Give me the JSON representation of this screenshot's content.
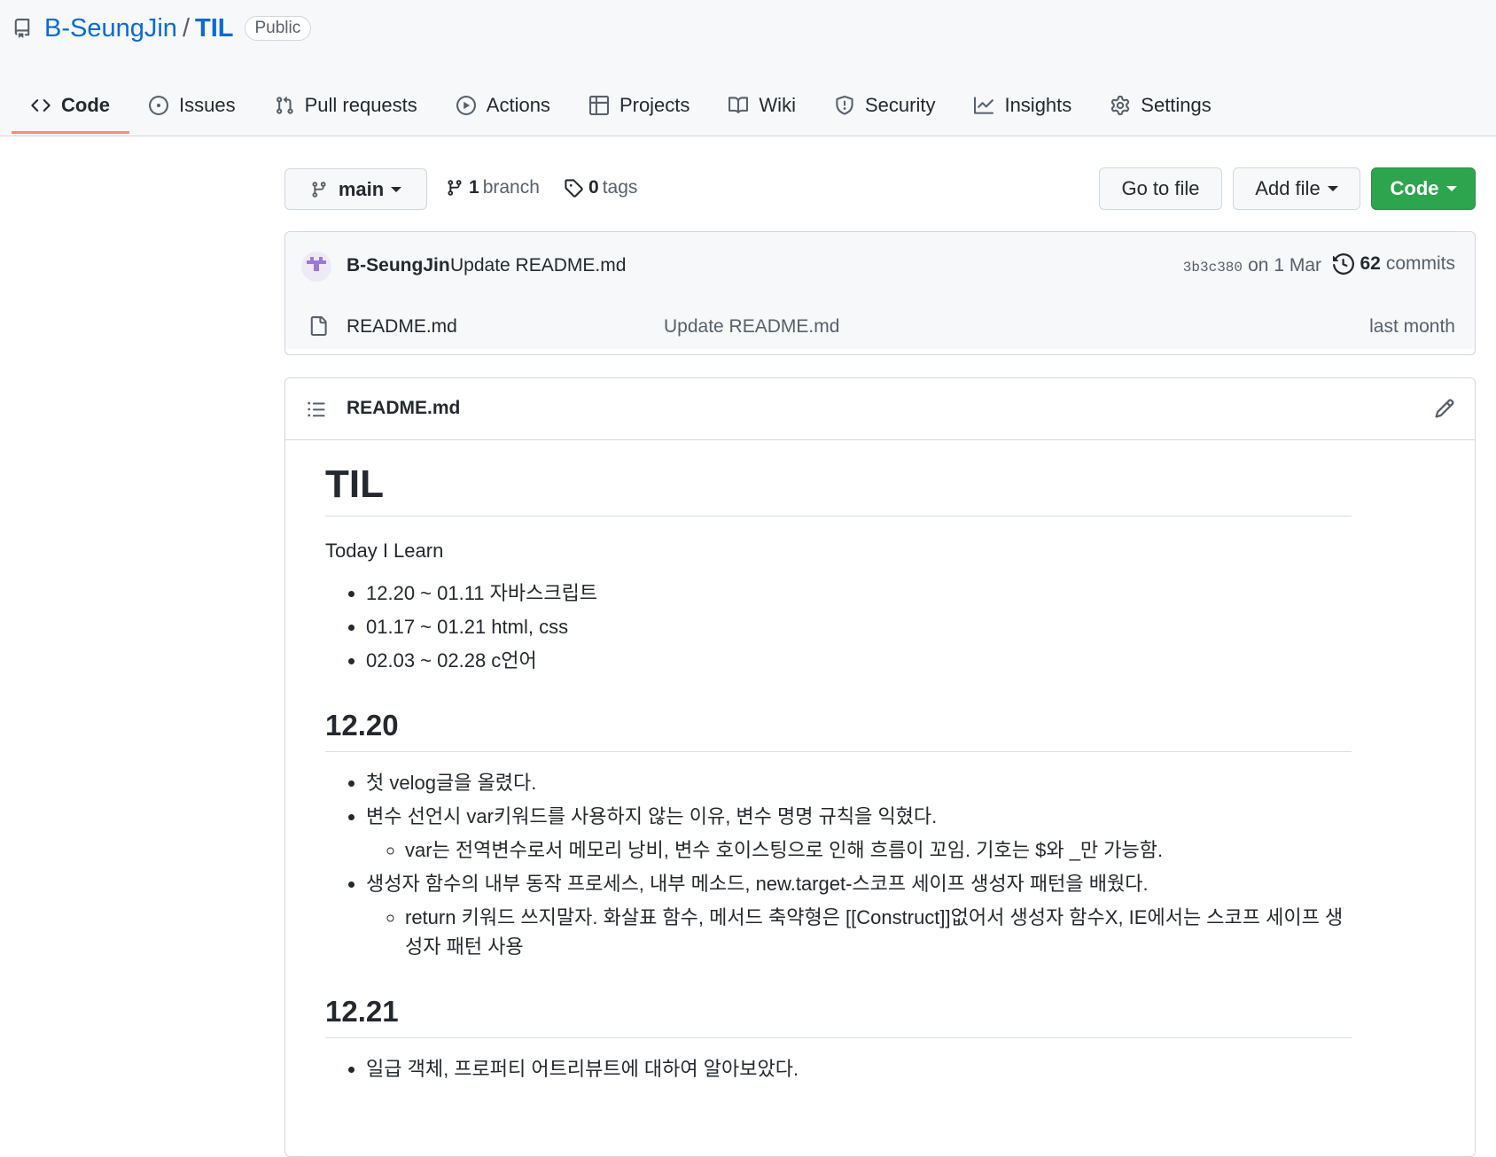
{
  "repo": {
    "owner": "B-SeungJin",
    "separator": "/",
    "name": "TIL",
    "visibility": "Public"
  },
  "tabs": [
    {
      "label": "Code",
      "icon": "code-icon",
      "active": true
    },
    {
      "label": "Issues",
      "icon": "issue-icon"
    },
    {
      "label": "Pull requests",
      "icon": "pull-request-icon"
    },
    {
      "label": "Actions",
      "icon": "play-icon"
    },
    {
      "label": "Projects",
      "icon": "table-icon"
    },
    {
      "label": "Wiki",
      "icon": "book-icon"
    },
    {
      "label": "Security",
      "icon": "shield-icon"
    },
    {
      "label": "Insights",
      "icon": "graph-icon"
    },
    {
      "label": "Settings",
      "icon": "gear-icon"
    }
  ],
  "toolbar": {
    "branch_name": "main",
    "branch_count": "1",
    "branch_label": "branch",
    "tag_count": "0",
    "tag_label": "tags",
    "go_to_file": "Go to file",
    "add_file": "Add file",
    "code": "Code"
  },
  "commit": {
    "author": "B-SeungJin",
    "message": "Update README.md",
    "sha": "3b3c380",
    "date": "on 1 Mar",
    "count": "62",
    "count_label": "commits"
  },
  "files": [
    {
      "name": "README.md",
      "message": "Update README.md",
      "age": "last month"
    }
  ],
  "readme": {
    "title": "README.md",
    "h1": "TIL",
    "intro": "Today I Learn",
    "toc": [
      "12.20 ~ 01.11 자바스크립트",
      "01.17 ~ 01.21 html, css",
      "02.03 ~ 02.28 c언어"
    ],
    "sections": [
      {
        "heading": "12.20",
        "items": [
          {
            "text": "첫 velog글을 올렸다."
          },
          {
            "text": "변수 선언시 var키워드를 사용하지 않는 이유, 변수 명명 규칙을 익혔다.",
            "sub": "var는 전역변수로서 메모리 낭비, 변수 호이스팅으로 인해 흐름이 꼬임. 기호는 $와 _만 가능함."
          },
          {
            "text": "생성자 함수의 내부 동작 프로세스, 내부 메소드, new.target-스코프 세이프 생성자 패턴을 배웠다.",
            "sub": "return 키워드 쓰지말자. 화살표 함수, 메서드 축약형은 [[Construct]]없어서 생성자 함수X, IE에서는 스코프 세이프 생성자 패턴 사용"
          }
        ]
      },
      {
        "heading": "12.21",
        "items": [
          {
            "text": "일급 객체, 프로퍼티 어트리뷰트에 대하여 알아보았다."
          }
        ]
      }
    ]
  },
  "colors": {
    "accent": "#fd8c73",
    "link": "#0969da",
    "primary_button": "#2da44e"
  }
}
